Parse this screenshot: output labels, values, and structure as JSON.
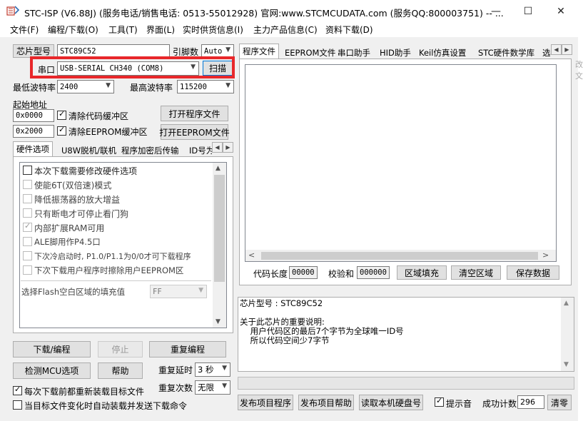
{
  "window": {
    "title": "STC-ISP (V6.88J) (服务电话/销售电话: 0513-55012928) 官网:www.STCMCUDATA.com  (服务QQ:800003751) -- ...",
    "minimize": "—",
    "maximize": "☐",
    "close": "✕"
  },
  "menu": [
    "文件(F)",
    "编程/下载(O)",
    "工具(T)",
    "界面(L)",
    "实时供货信息(I)",
    "主力产品信息(C)",
    "资料下载(D)"
  ],
  "left": {
    "chip_type_label": "芯片型号",
    "chip_type_value": "STC89C52",
    "pin_count_label": "引脚数",
    "pin_count_value": "Auto",
    "port_label": "串口",
    "port_value": "USB-SERIAL CH340 (COM8)",
    "scan_button": "扫描",
    "min_baud_label": "最低波特率",
    "min_baud_value": "2400",
    "max_baud_label": "最高波特率",
    "max_baud_value": "115200",
    "start_addr_label": "起始地址",
    "addr1": "0x0000",
    "clear_code_label": "清除代码缓冲区",
    "open_program_button": "打开程序文件",
    "addr2": "0x2000",
    "clear_eeprom_label": "清除EEPROM缓冲区",
    "open_eeprom_button": "打开EEPROM文件",
    "tabs": [
      "硬件选项",
      "U8W脱机/联机",
      "程序加密后传输",
      "ID号为"
    ],
    "hw_options": [
      {
        "label": "本次下载需要修改硬件选项",
        "checked": false
      },
      {
        "label": "使能6T(双倍速)模式",
        "checked": false
      },
      {
        "label": "降低振荡器的放大增益",
        "checked": false
      },
      {
        "label": "只有断电才可停止看门狗",
        "checked": false
      },
      {
        "label": "内部扩展RAM可用",
        "checked": true
      },
      {
        "label": "ALE脚用作P4.5口",
        "checked": false
      },
      {
        "label": "下次冷启动时, P1.0/P1.1为0/0才可下载程序",
        "checked": false
      },
      {
        "label": "下次下载用户程序时擦除用户EEPROM区",
        "checked": false
      }
    ],
    "fill_label": "选择Flash空白区域的填充值",
    "fill_value": "FF",
    "download_button": "下载/编程",
    "stop_button": "停止",
    "repeat_button": "重复编程",
    "check_mcu_button": "检测MCU选项",
    "help_button": "帮助",
    "repeat_delay_label": "重复延时",
    "repeat_delay_value": "3 秒",
    "repeat_count_label": "重复次数",
    "repeat_count_value": "无限",
    "reload_label": "每次下载前都重新装载目标文件",
    "auto_send_label": "当目标文件变化时自动装载并发送下载命令"
  },
  "right": {
    "tabs": [
      "程序文件",
      "EEPROM文件",
      "串口助手",
      "HID助手",
      "Keil仿真设置",
      "STC硬件数学库",
      "选"
    ],
    "code_len_label": "代码长度",
    "code_len_value": "00000",
    "checksum_label": "校验和",
    "checksum_value": "000000",
    "fill_area_button": "区域填充",
    "clear_area_button": "清空区域",
    "save_data_button": "保存数据",
    "info_lines": "芯片型号 : STC89C52\n\n关于此芯片的重要说明:\n    用户代码区的最后7个字节为全球唯一ID号\n    所以代码空间少7字节",
    "publish_program_button": "发布项目程序",
    "publish_help_button": "发布项目帮助",
    "read_disk_button": "读取本机硬盘号",
    "sound_label": "提示音",
    "success_label": "成功计数",
    "success_value": "296",
    "clear_button": "清零"
  },
  "side_fragment": [
    "改",
    "文"
  ]
}
